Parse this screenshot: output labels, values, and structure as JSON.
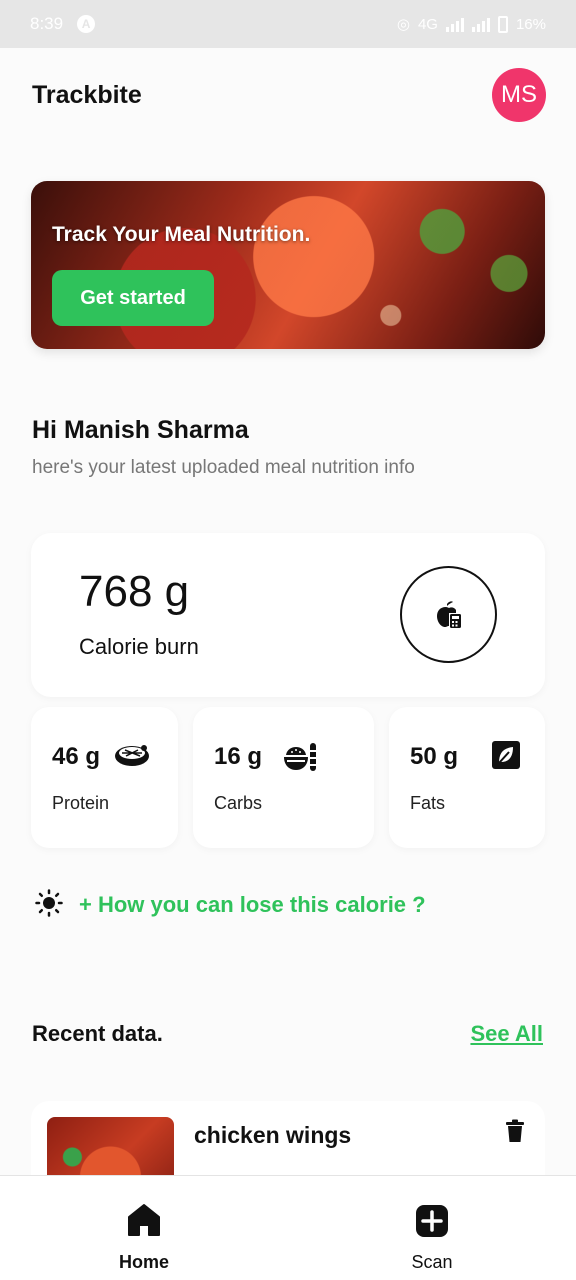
{
  "status_bar": {
    "time": "8:39",
    "network": "4G",
    "battery": "16%"
  },
  "header": {
    "title": "Trackbite",
    "avatar_initials": "MS"
  },
  "banner": {
    "title": "Track Your Meal Nutrition.",
    "button_label": "Get started"
  },
  "greeting": {
    "title": "Hi Manish Sharma",
    "subtitle": "here's your latest uploaded meal nutrition info"
  },
  "calorie": {
    "value": "768 g",
    "label": "Calorie burn"
  },
  "macros": [
    {
      "value": "46 g",
      "label": "Protein",
      "icon": "steak-icon"
    },
    {
      "value": "16 g",
      "label": "Carbs",
      "icon": "rice-bowl-icon"
    },
    {
      "value": "50 g",
      "label": "Fats",
      "icon": "leaf-icon"
    }
  ],
  "tip": {
    "link": "+ How you can lose this calorie ?"
  },
  "recent": {
    "title": "Recent data.",
    "see_all": "See All",
    "items": [
      {
        "name": "chicken wings"
      }
    ]
  },
  "nav": {
    "home": "Home",
    "scan": "Scan"
  },
  "colors": {
    "accent": "#2fc25b",
    "avatar": "#f0356b"
  }
}
